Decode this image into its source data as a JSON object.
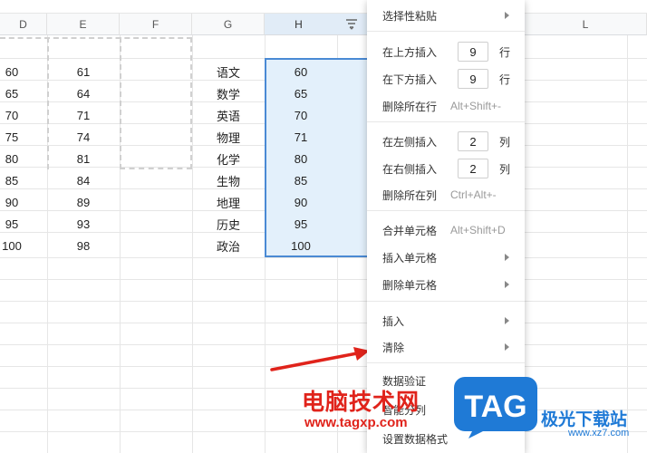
{
  "sheet": {
    "columns": [
      "D",
      "E",
      "F",
      "G",
      "H",
      "L"
    ],
    "rows": [
      {
        "d": "60",
        "e": "61",
        "g": "语文",
        "h": "60"
      },
      {
        "d": "65",
        "e": "64",
        "g": "数学",
        "h": "65"
      },
      {
        "d": "70",
        "e": "71",
        "g": "英语",
        "h": "70"
      },
      {
        "d": "75",
        "e": "74",
        "g": "物理",
        "h": "71"
      },
      {
        "d": "80",
        "e": "81",
        "g": "化学",
        "h": "80"
      },
      {
        "d": "85",
        "e": "84",
        "g": "生物",
        "h": "85"
      },
      {
        "d": "90",
        "e": "89",
        "g": "地理",
        "h": "90"
      },
      {
        "d": "95",
        "e": "93",
        "g": "历史",
        "h": "95"
      },
      {
        "d": "100",
        "e": "98",
        "g": "政治",
        "h": "100"
      }
    ],
    "selection_color": "#e3f0fb",
    "selection_border": "#4a8ad4"
  },
  "menu": {
    "paste_special": "选择性粘贴",
    "insert_above": {
      "label": "在上方插入",
      "value": "9",
      "unit": "行"
    },
    "insert_below": {
      "label": "在下方插入",
      "value": "9",
      "unit": "行"
    },
    "delete_row": {
      "label": "删除所在行",
      "shortcut": "Alt+Shift+-"
    },
    "insert_left": {
      "label": "在左侧插入",
      "value": "2",
      "unit": "列"
    },
    "insert_right": {
      "label": "在右侧插入",
      "value": "2",
      "unit": "列"
    },
    "delete_col": {
      "label": "删除所在列",
      "shortcut": "Ctrl+Alt+-"
    },
    "merge": {
      "label": "合并单元格",
      "shortcut": "Alt+Shift+D"
    },
    "insert_cells": "插入单元格",
    "delete_cells": "删除单元格",
    "insert": "插入",
    "clear": "清除",
    "data_validation": "数据验证",
    "smart_split": "智能分列",
    "format": "设置数据格式"
  },
  "watermark": {
    "cn": "电脑技术网",
    "url": "www.tagxp.com",
    "logo": "TAG",
    "right_cn": "极光下载站",
    "right_url": "www.xz7.com",
    "red": "#e0231b",
    "blue": "#1f7ad6"
  }
}
